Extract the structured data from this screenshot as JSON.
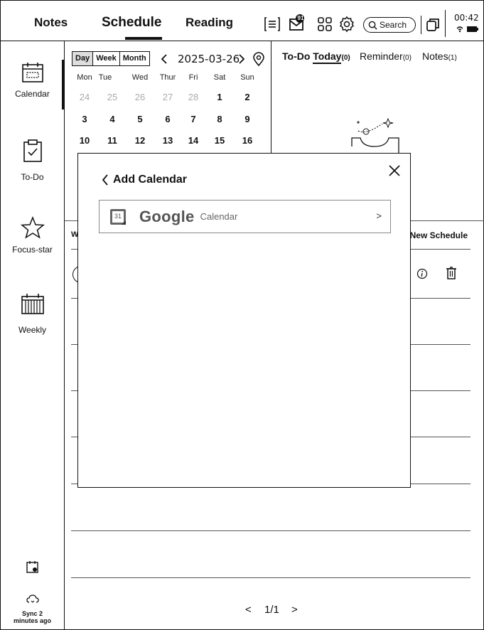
{
  "tabs": {
    "notes": "Notes",
    "schedule": "Schedule",
    "reading": "Reading"
  },
  "search": {
    "label": "Search"
  },
  "status": {
    "time": "00:42",
    "badge": "91"
  },
  "sidebar": {
    "calendar": "Calendar",
    "todo": "To-Do",
    "focus": "Focus-star",
    "weekly": "Weekly",
    "sync_line1": "Sync 2",
    "sync_line2": "minutes ago"
  },
  "calendar": {
    "view_day": "Day",
    "view_week": "Week",
    "view_month": "Month",
    "date": "2025-03-26",
    "weekdays": [
      "Mon",
      "Tue",
      "Wed",
      "Thur",
      "Fri",
      "Sat",
      "Sun"
    ],
    "rows": [
      [
        "24",
        "25",
        "26",
        "27",
        "28",
        "1",
        "2"
      ],
      [
        "3",
        "4",
        "5",
        "6",
        "7",
        "8",
        "9"
      ],
      [
        "10",
        "11",
        "12",
        "13",
        "14",
        "15",
        "16"
      ]
    ]
  },
  "right_tabs": {
    "todo_prefix": "To-Do",
    "todo_today": "Today",
    "todo_count": "(0)",
    "reminder": "Reminder",
    "reminder_count": "(0)",
    "notes": "Notes",
    "notes_count": "(1)"
  },
  "schedule": {
    "new_schedule": "New Schedule",
    "left_clip": "W"
  },
  "modal": {
    "title": "Add Calendar",
    "back_glyph": "<",
    "google_icon_num": "31",
    "google_logo": "Google",
    "google_sub": "Calendar",
    "chevron": ">"
  },
  "pager": {
    "prev": "<",
    "page": "1/1",
    "next": ">"
  }
}
